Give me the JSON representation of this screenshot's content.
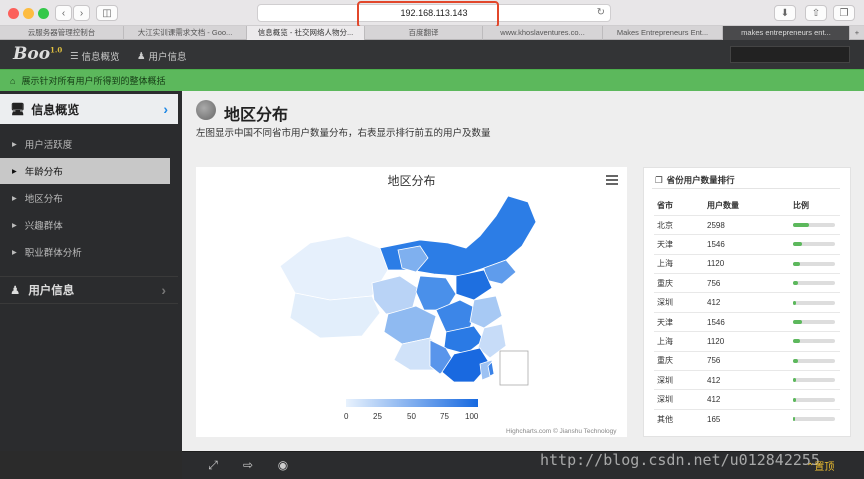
{
  "browser": {
    "address": "192.168.113.143",
    "tabs": [
      {
        "label": "云服务器管理控制台",
        "active": false
      },
      {
        "label": "大江实训课需求文档 - Goo...",
        "active": false
      },
      {
        "label": "信息概览 - 社交网络人物分...",
        "active": true
      },
      {
        "label": "百度翻译",
        "active": false
      },
      {
        "label": "www.khoslaventures.co...",
        "active": false
      },
      {
        "label": "Makes Entrepreneurs Ent...",
        "active": false
      },
      {
        "label": "makes entrepreneurs ent...",
        "active": false
      }
    ]
  },
  "header": {
    "logo": "Boo",
    "logo_version": "1.0",
    "nav_overview": "信息概览",
    "nav_user": "用户信息"
  },
  "notice": "展示针对所有用户所得到的整体概括",
  "sidebar": {
    "section_overview": "信息概览",
    "items": [
      "用户活跃度",
      "年龄分布",
      "地区分布",
      "兴趣群体",
      "职业群体分析"
    ],
    "active_index": 1,
    "section_user": "用户信息"
  },
  "page": {
    "title": "地区分布",
    "description": "左图显示中国不同省市用户数量分布，右表显示排行前五的用户及数量"
  },
  "map": {
    "title": "地区分布",
    "legend_ticks": [
      "0",
      "25",
      "50",
      "75",
      "100"
    ],
    "credits": "Highcharts.com © Jianshu Technology",
    "color_low": "#e8f2fd",
    "color_high": "#1769e0"
  },
  "ranking": {
    "title": "省份用户数量排行",
    "headers": [
      "省市",
      "用户数量",
      "比例"
    ],
    "rows": [
      {
        "city": "北京",
        "count": "2598",
        "ratio": 0.38
      },
      {
        "city": "天津",
        "count": "1546",
        "ratio": 0.22
      },
      {
        "city": "上海",
        "count": "1120",
        "ratio": 0.16
      },
      {
        "city": "重庆",
        "count": "756",
        "ratio": 0.11
      },
      {
        "city": "深圳",
        "count": "412",
        "ratio": 0.06
      },
      {
        "city": "天津",
        "count": "1546",
        "ratio": 0.22
      },
      {
        "city": "上海",
        "count": "1120",
        "ratio": 0.16
      },
      {
        "city": "重庆",
        "count": "756",
        "ratio": 0.11
      },
      {
        "city": "深圳",
        "count": "412",
        "ratio": 0.06
      },
      {
        "city": "深圳",
        "count": "412",
        "ratio": 0.06
      },
      {
        "city": "其他",
        "count": "165",
        "ratio": 0.02
      }
    ]
  },
  "footer": {
    "totop": "置顶",
    "watermark": "http://blog.csdn.net/u012842255"
  }
}
